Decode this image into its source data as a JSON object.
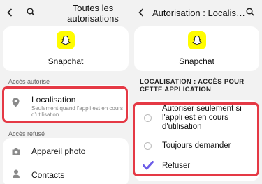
{
  "left": {
    "title": "Toutes les autorisations",
    "app_name": "Snapchat",
    "allowed_section": "Accès autorisé",
    "location": {
      "title": "Localisation",
      "subtitle": "Seulement quand l'appli est en cours d'utilisation"
    },
    "denied_section": "Accès refusé",
    "denied": [
      {
        "label": "Appareil photo",
        "icon": "camera-icon"
      },
      {
        "label": "Contacts",
        "icon": "contacts-icon"
      }
    ]
  },
  "right": {
    "title": "Autorisation : Localis…",
    "app_name": "Snapchat",
    "section": "LOCALISATION : ACCÈS POUR CETTE APPLICATION",
    "options": [
      {
        "label": "Autoriser seulement si l'appli est en cours d'utilisation",
        "selected": false
      },
      {
        "label": "Toujours demander",
        "selected": false
      },
      {
        "label": "Refuser",
        "selected": true
      }
    ]
  },
  "colors": {
    "accent": "#6b5ce7",
    "highlight": "#e53945",
    "snapchat": "#fffc00"
  }
}
